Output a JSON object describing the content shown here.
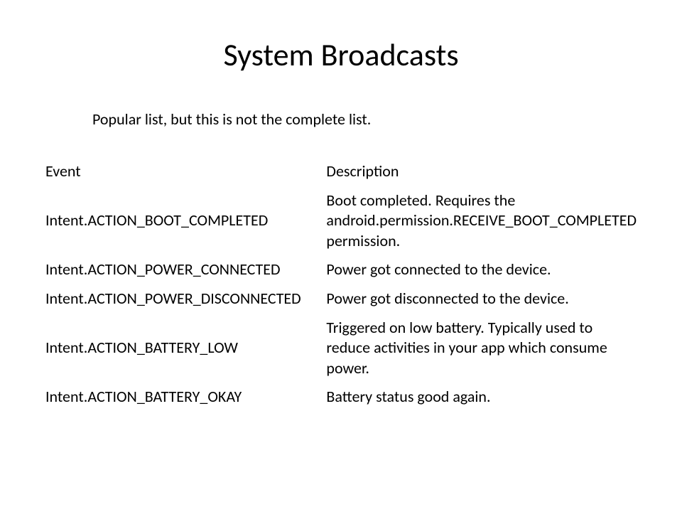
{
  "title": "System Broadcasts",
  "subtitle": "Popular list, but this is not the complete list.",
  "headers": {
    "event": "Event",
    "description": "Description"
  },
  "rows": [
    {
      "event": "Intent.ACTION_BOOT_COMPLETED",
      "description": "Boot completed. Requires the android.permission.RECEIVE_BOOT_COMPLETED permission."
    },
    {
      "event": "Intent.ACTION_POWER_CONNECTED",
      "description": "Power got connected to the device."
    },
    {
      "event": "Intent.ACTION_POWER_DISCONNECTED",
      "description": "Power got disconnected to the device."
    },
    {
      "event": "Intent.ACTION_BATTERY_LOW",
      "description": "Triggered on low battery. Typically used to reduce activities in your app which consume power."
    },
    {
      "event": "Intent.ACTION_BATTERY_OKAY",
      "description": "Battery status good again."
    }
  ]
}
